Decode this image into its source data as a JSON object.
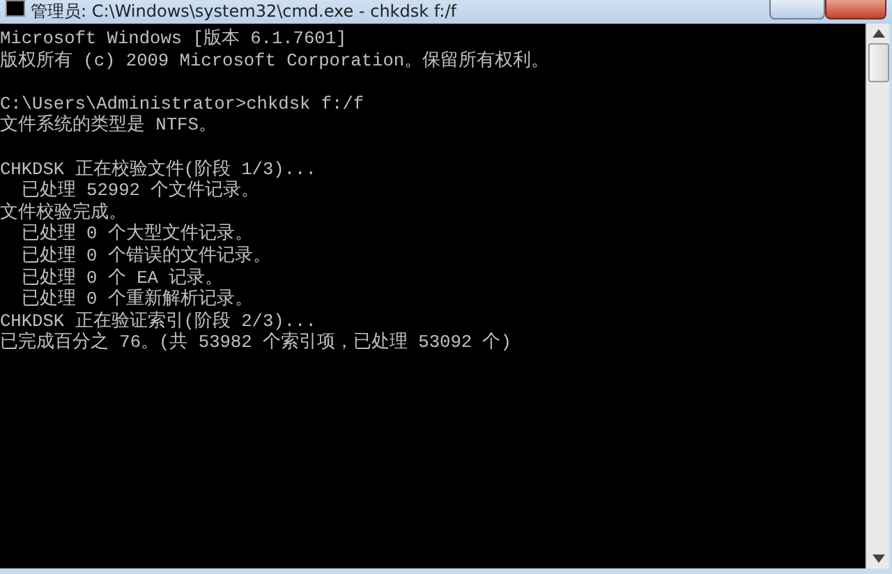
{
  "window": {
    "title": "管理员: C:\\Windows\\system32\\cmd.exe - chkdsk  f:/f"
  },
  "console": {
    "blocks": [
      [
        "Microsoft Windows [版本 6.1.7601]",
        "版权所有 (c) 2009 Microsoft Corporation。保留所有权利。"
      ],
      [
        "C:\\Users\\Administrator>chkdsk f:/f",
        "文件系统的类型是 NTFS。"
      ],
      [
        "CHKDSK 正在校验文件(阶段 1/3)...",
        "  已处理 52992 个文件记录。",
        "文件校验完成。",
        "  已处理 0 个大型文件记录。",
        "  已处理 0 个错误的文件记录。",
        "  已处理 0 个 EA 记录。",
        "  已处理 0 个重新解析记录。",
        "CHKDSK 正在验证索引(阶段 2/3)...",
        "已完成百分之 76。(共 53982 个索引项，已处理 53092 个)"
      ]
    ]
  }
}
